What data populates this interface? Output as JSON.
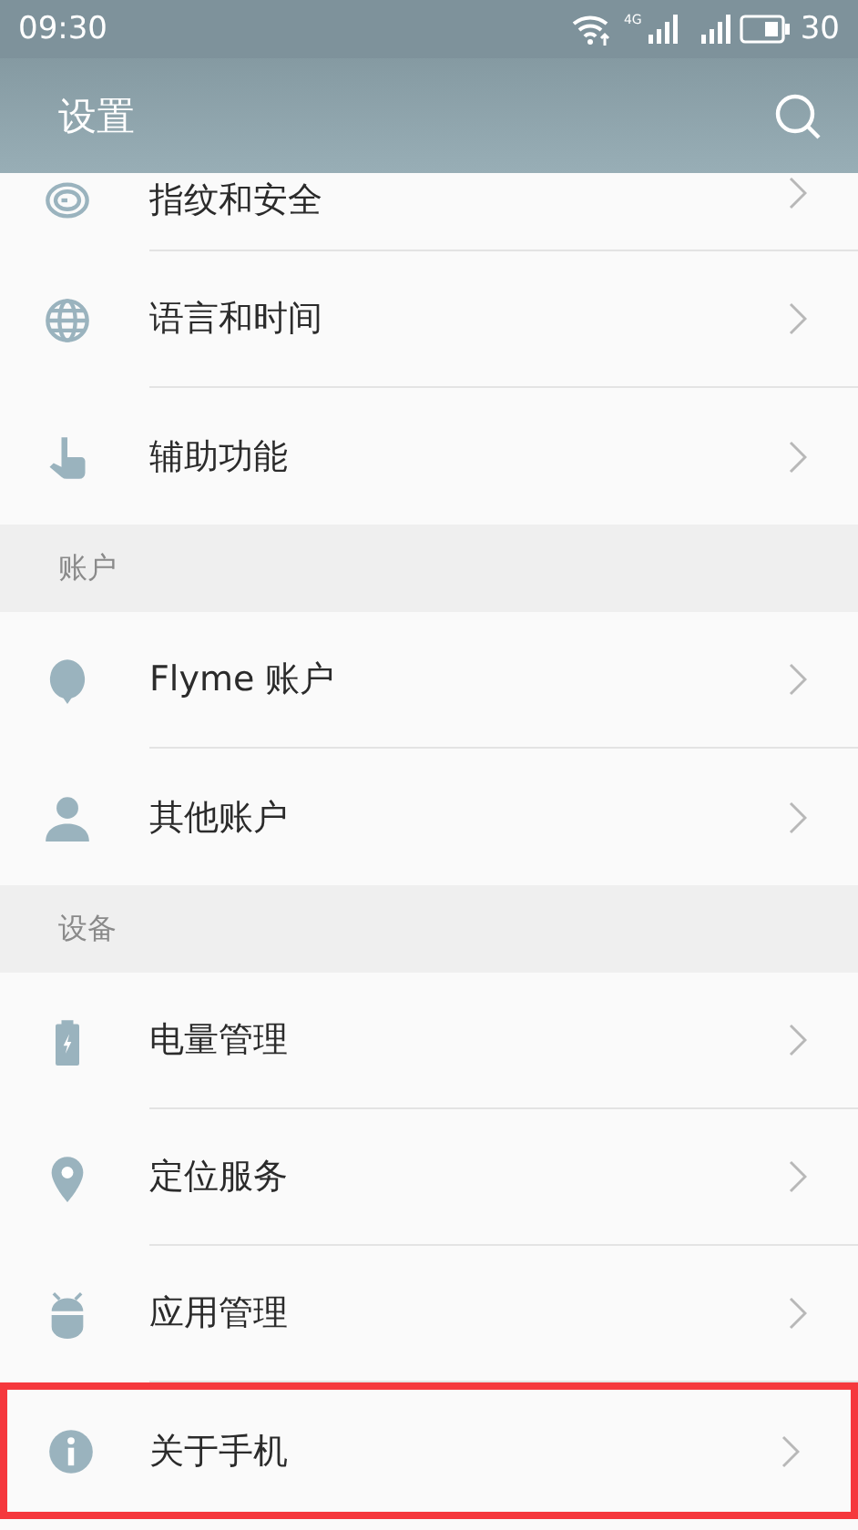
{
  "status_bar": {
    "time": "09:30",
    "network": "4G",
    "battery": "30"
  },
  "header": {
    "title": "设置"
  },
  "sections": [
    {
      "items": [
        {
          "label": "指纹和安全",
          "clipped": true,
          "highlighted": false
        },
        {
          "label": "语言和时间",
          "clipped": false,
          "highlighted": false
        },
        {
          "label": "辅助功能",
          "clipped": false,
          "highlighted": false
        }
      ]
    },
    {
      "title": "账户",
      "items": [
        {
          "label": "Flyme 账户",
          "clipped": false,
          "highlighted": false
        },
        {
          "label": "其他账户",
          "clipped": false,
          "highlighted": false
        }
      ]
    },
    {
      "title": "设备",
      "items": [
        {
          "label": "电量管理",
          "clipped": false,
          "highlighted": false
        },
        {
          "label": "定位服务",
          "clipped": false,
          "highlighted": false
        },
        {
          "label": "应用管理",
          "clipped": false,
          "highlighted": false
        },
        {
          "label": "关于手机",
          "clipped": false,
          "highlighted": true
        }
      ]
    }
  ]
}
